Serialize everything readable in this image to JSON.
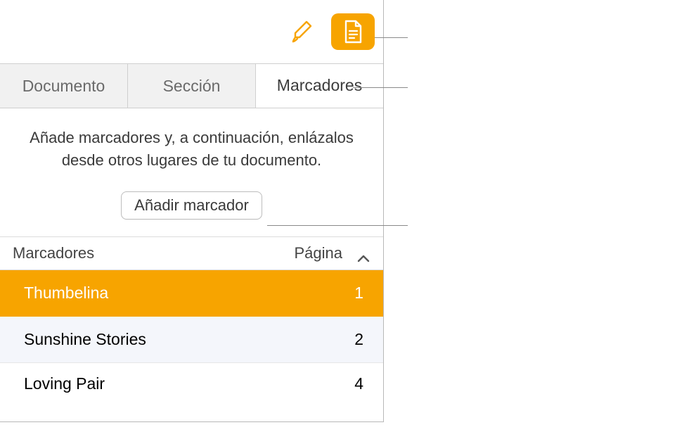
{
  "colors": {
    "accent": "#f7a400"
  },
  "toolbar": {
    "format_icon": "format-brush-icon",
    "document_icon": "document-icon"
  },
  "tabs": {
    "items": [
      {
        "label": "Documento",
        "active": false
      },
      {
        "label": "Sección",
        "active": false
      },
      {
        "label": "Marcadores",
        "active": true
      }
    ]
  },
  "intro": {
    "text": "Añade marcadores y, a continuación, enlázalos desde otros lugares de tu documento."
  },
  "add_button": {
    "label": "Añadir marcador"
  },
  "list_header": {
    "name_col": "Marcadores",
    "page_col": "Página"
  },
  "bookmarks": [
    {
      "name": "Thumbelina",
      "page": "1",
      "selected": true
    },
    {
      "name": "Sunshine Stories",
      "page": "2",
      "selected": false
    },
    {
      "name": "Loving Pair",
      "page": "4",
      "selected": false
    }
  ]
}
